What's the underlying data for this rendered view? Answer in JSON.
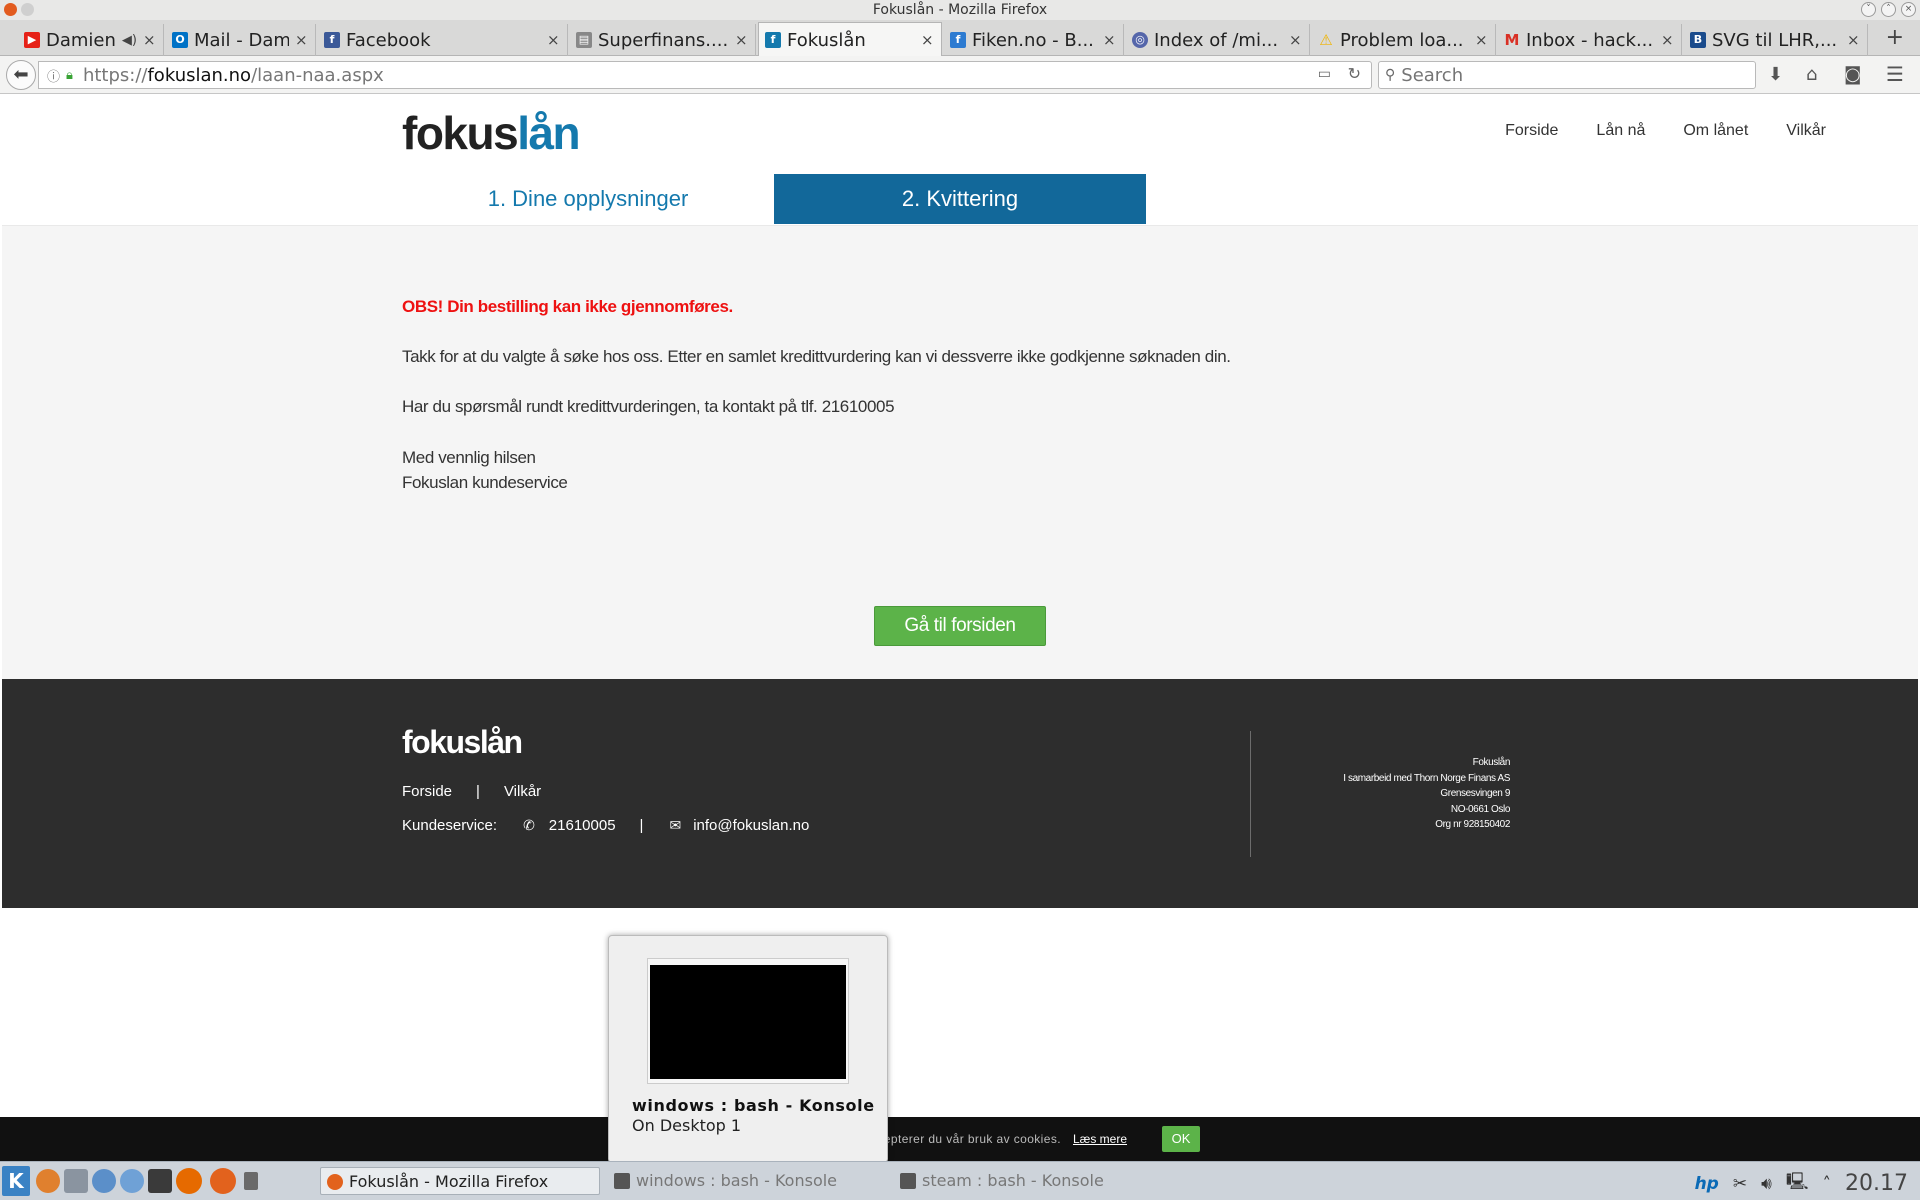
{
  "window": {
    "title": "Fokuslån - Mozilla Firefox"
  },
  "tabs": [
    {
      "label": "Damien R...",
      "favicon": "youtube-icon",
      "color": "#e62117"
    },
    {
      "label": "Mail - Dami...",
      "favicon": "outlook-icon",
      "color": "#0072c6"
    },
    {
      "label": "Facebook",
      "favicon": "facebook-icon",
      "color": "#3b5998"
    },
    {
      "label": "Superfinans....",
      "favicon": "page-icon",
      "color": "#888888"
    },
    {
      "label": "Fokuslån",
      "favicon": "fokuslan-icon",
      "color": "#1479ad"
    },
    {
      "label": "Fiken.no - B...",
      "favicon": "fiken-icon",
      "color": "#2d7bd1"
    },
    {
      "label": "Index of /mi...",
      "favicon": "globe-icon",
      "color": "#5566aa"
    },
    {
      "label": "Problem loa...",
      "favicon": "warning-icon",
      "color": "#f0b400"
    },
    {
      "label": "Inbox - hack...",
      "favicon": "gmail-icon",
      "color": "#d93025"
    },
    {
      "label": "SVG til LHR,...",
      "favicon": "b-icon",
      "color": "#1a4b8c"
    }
  ],
  "navbar": {
    "url_prefix": "https://",
    "url_host": "fokuslan.no",
    "url_path": "/laan-naa.aspx",
    "search_placeholder": "Search"
  },
  "site": {
    "logo_focus": "fokus",
    "logo_laan": "lån",
    "nav": [
      "Forside",
      "Lån nå",
      "Om lånet",
      "Vilkår"
    ],
    "steps": [
      "1. Dine opplysninger",
      "2. Kvittering"
    ]
  },
  "content": {
    "obs": "OBS! Din bestilling kan ikke gjennomføres.",
    "thanks": "Takk for at du valgte å søke hos oss. Etter en samlet kredittvurdering kan vi dessverre ikke godkjenne søknaden din.",
    "question": "Har du spørsmål rundt kredittvurderingen, ta kontakt på tlf. 21610005",
    "regards": "Med vennlig hilsen",
    "signature": "Fokuslan kundeservice",
    "home_button": "Gå til forsiden"
  },
  "footer": {
    "links": [
      "Forside",
      "Vilkår"
    ],
    "separator": "|",
    "customer_service_label": "Kundeservice:",
    "phone": "21610005",
    "email": "info@fokuslan.no",
    "company": [
      "Fokuslån",
      "I samarbeid med Thorn Norge Finans AS",
      "Grensesvingen 9",
      "NO-0661 Oslo",
      "Org nr 928150402"
    ]
  },
  "cookie": {
    "text": "Hvis du fortsetter på siden aksepterer du vår bruk av cookies.",
    "more": "Læs mere",
    "ok": "OK"
  },
  "task_popup": {
    "title": "windows : bash - Konsole",
    "subtitle": "On Desktop 1"
  },
  "taskbar": {
    "tasks": [
      "Fokuslån - Mozilla Firefox",
      "windows : bash - Konsole",
      "steam : bash - Konsole"
    ],
    "clock": "20.17"
  },
  "colors": {
    "brand_blue": "#1479ad",
    "step_active": "#12689a",
    "button_green": "#5cb349",
    "error_red": "#ee1111",
    "footer_bg": "#2d2d2d"
  }
}
